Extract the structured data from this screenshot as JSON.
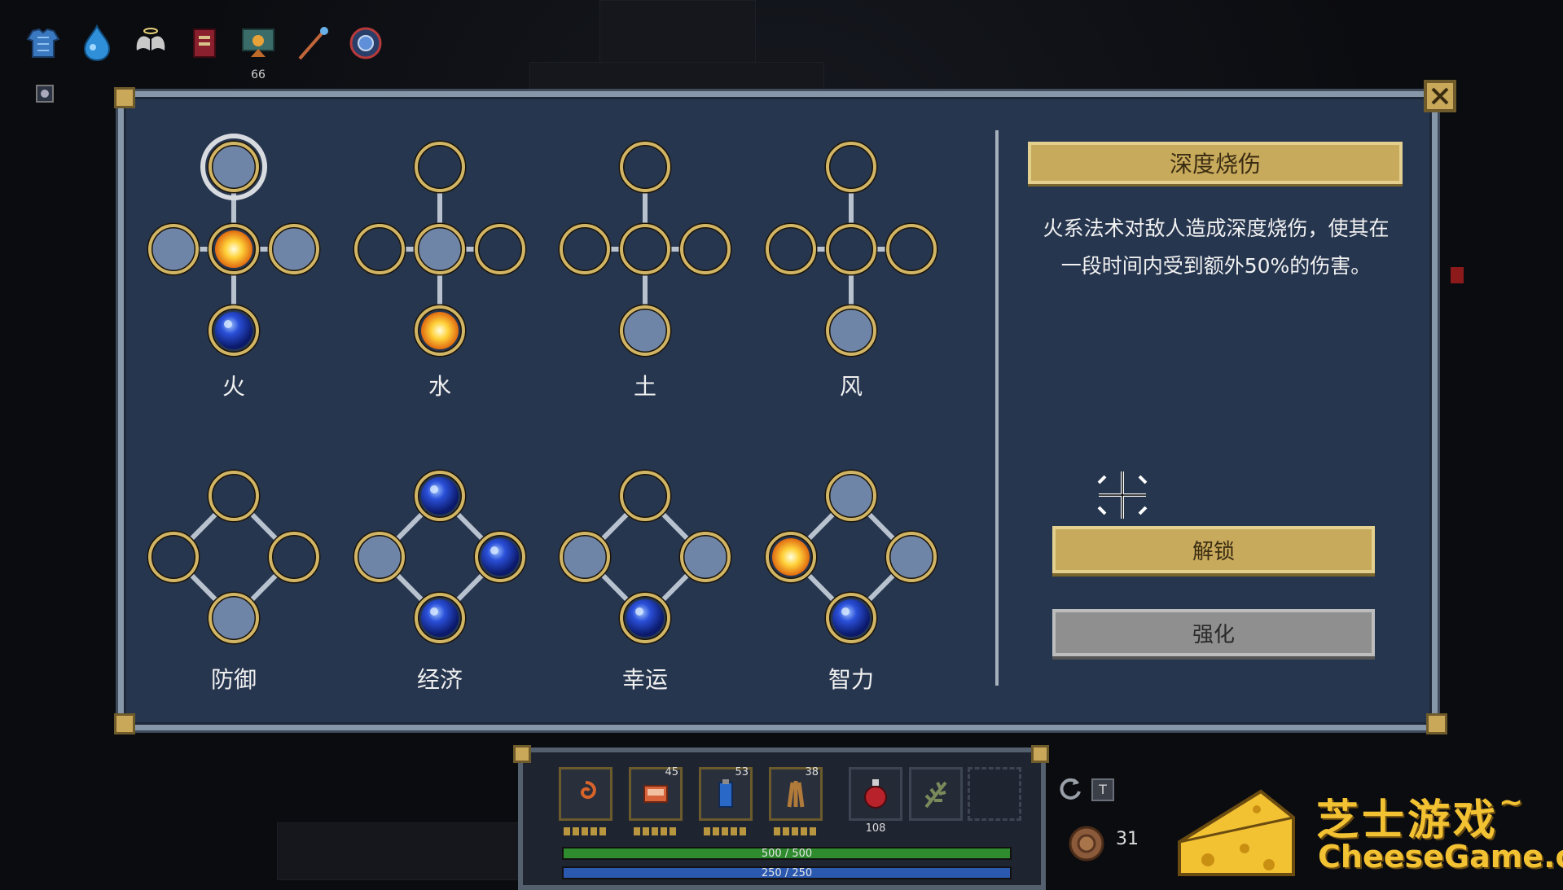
{
  "top_bar": {
    "items": [
      {
        "icon": "armor-icon"
      },
      {
        "icon": "potion-flask-icon"
      },
      {
        "icon": "wings-icon"
      },
      {
        "icon": "spellbook-icon"
      },
      {
        "icon": "pet-icon",
        "count": "66"
      },
      {
        "icon": "staff-icon"
      },
      {
        "icon": "rune-orb-icon"
      }
    ]
  },
  "talent_trees": [
    {
      "label": "火"
    },
    {
      "label": "水"
    },
    {
      "label": "土"
    },
    {
      "label": "风"
    },
    {
      "label": "防御"
    },
    {
      "label": "经济"
    },
    {
      "label": "幸运"
    },
    {
      "label": "智力"
    }
  ],
  "details": {
    "title": "深度烧伤",
    "description_line1": "火系法术对敌人造成深度烧伤，使其在",
    "description_line2": "一段时间内受到额外50%的伤害。",
    "unlock_label": "解锁",
    "enhance_label": "强化"
  },
  "hotbar": {
    "slots": [
      {
        "icon": "swirl-spell-icon",
        "count": ""
      },
      {
        "icon": "scroll-item-icon",
        "count": "45"
      },
      {
        "icon": "mana-potion-icon",
        "count": "53"
      },
      {
        "icon": "herb-bundle-icon",
        "count": "38"
      }
    ],
    "potion": {
      "icon": "health-potion-icon",
      "count": "108"
    },
    "herb": {
      "icon": "leaf-icon"
    },
    "hp_text": "500 / 500",
    "mp_text": "250 / 250",
    "hp_fraction": 1.0,
    "mp_fraction": 1.0
  },
  "side": {
    "key_hint": "T",
    "coin_count": "31"
  },
  "watermark": {
    "cn": "芝士游戏",
    "tilde": "~",
    "en": "CheeseGame.org"
  },
  "colors": {
    "panel": "#27364f",
    "gold": "#c8aa5c",
    "fire_orb": "#ffd23a",
    "water_orb": "#2a4fd8",
    "empty_node": "#6f85a8"
  }
}
